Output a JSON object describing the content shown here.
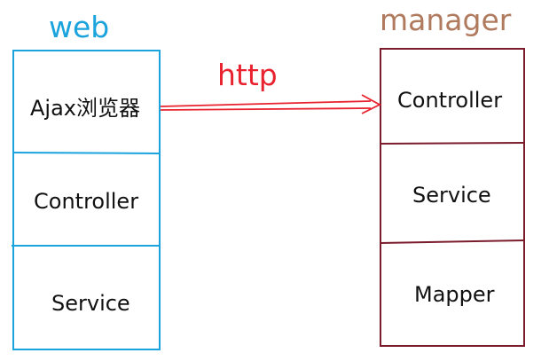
{
  "colors": {
    "web_accent": "#1aa3dc",
    "manager_accent": "#b07a5e",
    "manager_box": "#7b1c2c",
    "arrow": "#e8232f",
    "text": "#111111"
  },
  "web": {
    "title": "web",
    "layers": [
      "Ajax浏览器",
      "Controller",
      "Service"
    ]
  },
  "manager": {
    "title": "manager",
    "layers": [
      "Controller",
      "Service",
      "Mapper"
    ]
  },
  "connection": {
    "label": "http",
    "from": "web.layers.0",
    "to": "manager.layers.0",
    "style": "double-line-arrow"
  }
}
